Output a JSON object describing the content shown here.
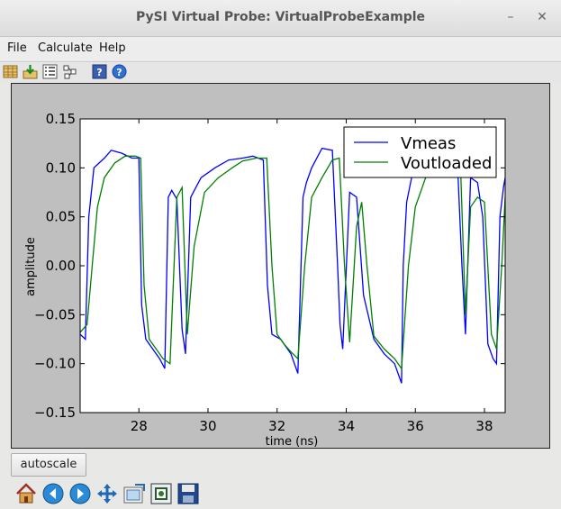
{
  "window": {
    "title": "PySI Virtual Probe: VirtualProbeExample",
    "minimize": "–",
    "close": "✕"
  },
  "menu": {
    "file": "File",
    "calculate": "Calculate",
    "help": "Help"
  },
  "toolbar": {
    "icons": [
      "open-project-icon",
      "save-project-icon",
      "properties-icon",
      "netlist-icon",
      "help-book-icon",
      "help-icon"
    ]
  },
  "bottom": {
    "autoscale_label": "autoscale",
    "nav_icons": [
      "home-icon",
      "back-icon",
      "forward-icon",
      "pan-icon",
      "configure-subplots-icon",
      "zoom-icon",
      "save-figure-icon"
    ]
  },
  "colors": {
    "vmeas": "#0000ff",
    "voutloaded": "#008000",
    "plot_bg": "#bfbfbf"
  },
  "chart_data": {
    "type": "line",
    "xlabel": "time (ns)",
    "ylabel": "amplitude",
    "xlim": [
      26.3,
      38.6
    ],
    "ylim": [
      -0.15,
      0.15
    ],
    "xticks": [
      28,
      30,
      32,
      34,
      36,
      38
    ],
    "yticks": [
      0.15,
      0.1,
      0.05,
      0.0,
      -0.05,
      -0.1,
      -0.15
    ],
    "xtick_labels": [
      "28",
      "30",
      "32",
      "34",
      "36",
      "38"
    ],
    "ytick_labels": [
      "0.15",
      "0.10",
      "0.05",
      "0.00",
      "−0.05",
      "−0.10",
      "−0.15"
    ],
    "legend_position": "top-right",
    "series": [
      {
        "name": "Vmeas",
        "color": "#0000ff",
        "x": [
          26.3,
          26.45,
          26.55,
          26.7,
          26.85,
          27.0,
          27.2,
          27.5,
          27.8,
          28.0,
          28.08,
          28.2,
          28.4,
          28.6,
          28.75,
          28.85,
          28.95,
          29.1,
          29.25,
          29.35,
          29.5,
          29.8,
          30.2,
          30.6,
          31.0,
          31.3,
          31.6,
          31.72,
          31.85,
          32.1,
          32.4,
          32.6,
          32.75,
          32.85,
          33.0,
          33.3,
          33.6,
          33.75,
          33.82,
          33.9,
          34.1,
          34.3,
          34.5,
          34.8,
          35.1,
          35.4,
          35.6,
          35.65,
          35.75,
          35.95,
          36.3,
          36.7,
          37.0,
          37.2,
          37.35,
          37.45,
          37.6,
          37.8,
          37.95,
          38.1,
          38.25,
          38.35,
          38.45,
          38.55,
          38.6
        ],
        "y": [
          -0.07,
          -0.075,
          0.05,
          0.1,
          0.105,
          0.11,
          0.118,
          0.115,
          0.11,
          0.11,
          -0.04,
          -0.075,
          -0.085,
          -0.095,
          -0.105,
          0.07,
          0.077,
          0.068,
          -0.065,
          -0.09,
          0.07,
          0.09,
          0.1,
          0.108,
          0.11,
          0.112,
          0.108,
          -0.02,
          -0.07,
          -0.075,
          -0.09,
          -0.11,
          0.07,
          0.085,
          0.1,
          0.12,
          0.118,
          0.0,
          -0.06,
          -0.085,
          0.075,
          0.07,
          -0.03,
          -0.075,
          -0.09,
          -0.1,
          -0.12,
          0.0,
          0.065,
          0.1,
          0.12,
          0.12,
          0.12,
          0.12,
          0.0,
          -0.07,
          0.09,
          0.085,
          0.05,
          -0.08,
          -0.095,
          -0.1,
          0.05,
          0.08,
          0.09
        ]
      },
      {
        "name": "Voutloaded",
        "color": "#008000",
        "x": [
          26.3,
          26.5,
          26.65,
          26.8,
          27.0,
          27.3,
          27.6,
          27.9,
          28.05,
          28.15,
          28.3,
          28.5,
          28.7,
          28.9,
          29.1,
          29.25,
          29.4,
          29.6,
          29.9,
          30.3,
          30.7,
          31.0,
          31.4,
          31.7,
          31.85,
          32.0,
          32.2,
          32.4,
          32.6,
          32.8,
          33.0,
          33.3,
          33.6,
          33.8,
          33.95,
          34.1,
          34.3,
          34.45,
          34.6,
          34.8,
          35.1,
          35.4,
          35.6,
          35.8,
          36.0,
          36.3,
          36.7,
          37.1,
          37.3,
          37.45,
          37.6,
          37.8,
          38.0,
          38.2,
          38.35,
          38.5,
          38.6
        ],
        "y": [
          -0.068,
          -0.06,
          0.0,
          0.06,
          0.09,
          0.105,
          0.112,
          0.112,
          0.11,
          -0.02,
          -0.075,
          -0.085,
          -0.095,
          -0.1,
          0.07,
          0.08,
          -0.07,
          0.02,
          0.075,
          0.09,
          0.1,
          0.107,
          0.11,
          0.11,
          0.0,
          -0.07,
          -0.08,
          -0.088,
          -0.095,
          0.0,
          0.07,
          0.09,
          0.108,
          0.11,
          0.0,
          -0.078,
          0.04,
          0.065,
          0.0,
          -0.072,
          -0.085,
          -0.095,
          -0.105,
          0.0,
          0.06,
          0.09,
          0.11,
          0.113,
          0.11,
          -0.05,
          0.06,
          0.07,
          0.065,
          -0.07,
          -0.085,
          0.0,
          0.07
        ]
      }
    ]
  }
}
